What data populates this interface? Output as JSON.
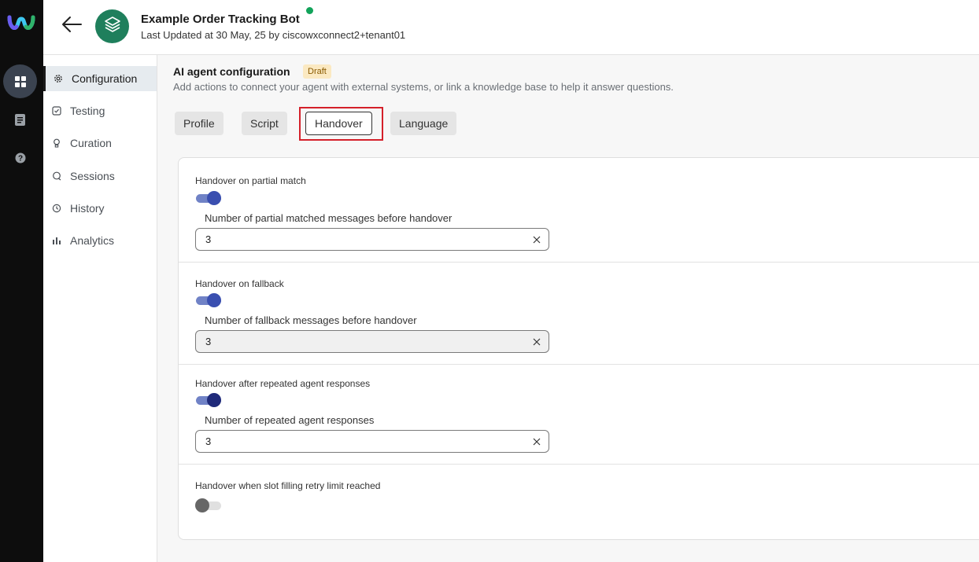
{
  "header": {
    "title": "Example Order Tracking Bot",
    "subtitle": "Last Updated at 30 May, 25 by ciscowxconnect2+tenant01",
    "status_color": "#12a35a"
  },
  "rail": {
    "items": [
      {
        "icon": "grid-icon",
        "active": true
      },
      {
        "icon": "document-icon",
        "active": false
      },
      {
        "icon": "help-icon",
        "active": false
      }
    ]
  },
  "nav": {
    "items": [
      {
        "label": "Configuration",
        "icon": "gear-icon",
        "active": true
      },
      {
        "label": "Testing",
        "icon": "test-icon"
      },
      {
        "label": "Curation",
        "icon": "lightbulb-icon"
      },
      {
        "label": "Sessions",
        "icon": "chat-icon"
      },
      {
        "label": "History",
        "icon": "history-icon"
      },
      {
        "label": "Analytics",
        "icon": "bar-chart-icon"
      }
    ]
  },
  "main": {
    "title": "AI agent configuration",
    "badge": "Draft",
    "description": "Add actions to connect your agent with external systems, or link a knowledge base to help it answer questions.",
    "tabs": [
      {
        "label": "Profile"
      },
      {
        "label": "Script"
      },
      {
        "label": "Handover",
        "active": true
      },
      {
        "label": "Language"
      }
    ]
  },
  "handover": {
    "partial_match": {
      "label": "Handover on partial match",
      "enabled": true,
      "field_label": "Number of partial matched messages before handover",
      "value": "3"
    },
    "fallback": {
      "label": "Handover on fallback",
      "enabled": true,
      "field_label": "Number of fallback messages before handover",
      "value": "3"
    },
    "repeated": {
      "label": "Handover after repeated agent responses",
      "enabled": true,
      "field_label": "Number of repeated agent responses",
      "value": "3"
    },
    "slot_filling": {
      "label": "Handover when slot filling retry limit reached",
      "enabled": false
    }
  }
}
